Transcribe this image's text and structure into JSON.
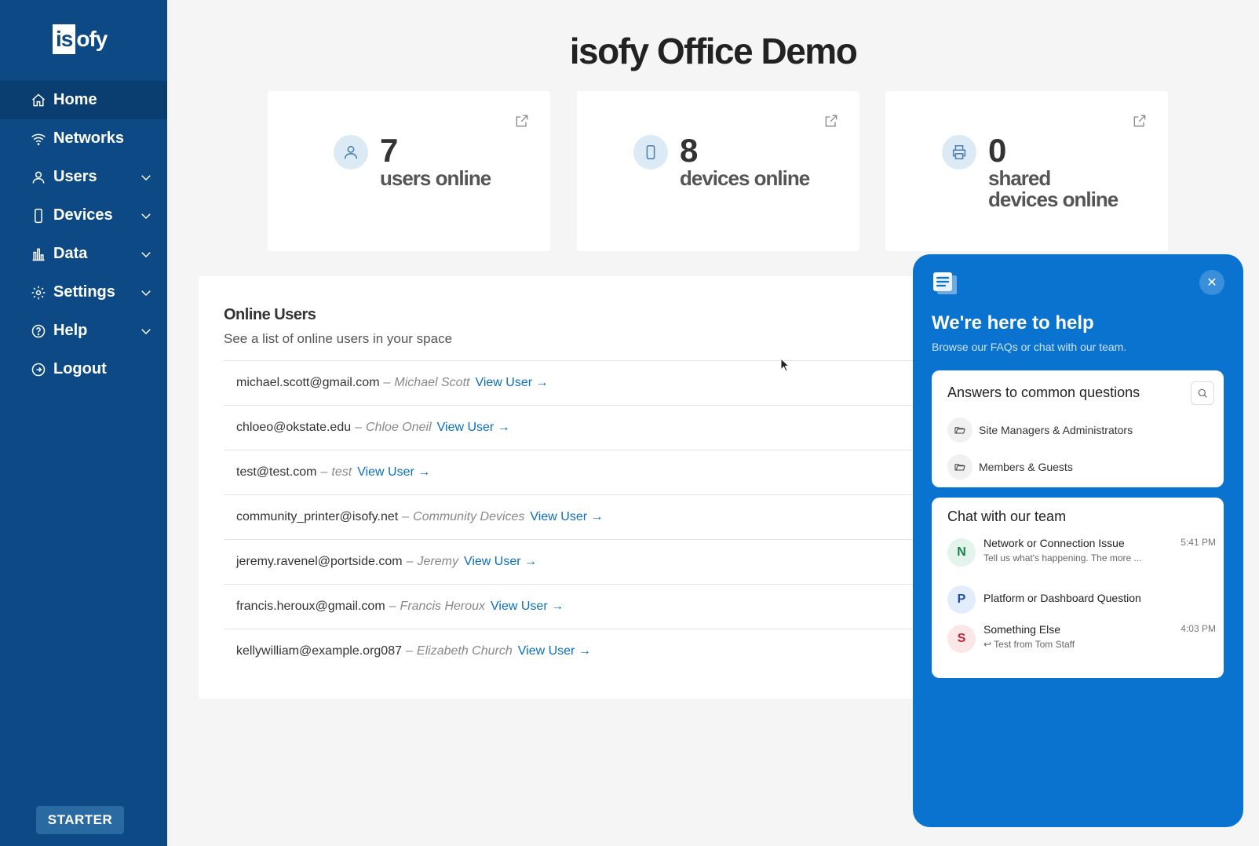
{
  "sidebar": {
    "logo_box": "is",
    "logo_rest": "ofy",
    "items": [
      {
        "label": "Home"
      },
      {
        "label": "Networks"
      },
      {
        "label": "Users"
      },
      {
        "label": "Devices"
      },
      {
        "label": "Data"
      },
      {
        "label": "Settings"
      },
      {
        "label": "Help"
      },
      {
        "label": "Logout"
      }
    ],
    "plan": "STARTER"
  },
  "main": {
    "title": "isofy Office Demo",
    "stats": [
      {
        "value": "7",
        "label_line1": "users online",
        "label_line2": ""
      },
      {
        "value": "8",
        "label_line1": "devices online",
        "label_line2": ""
      },
      {
        "value": "0",
        "label_line1": "shared",
        "label_line2": "devices online"
      }
    ],
    "online_users": {
      "title": "Online Users",
      "subtitle": "See a list of online users in your space",
      "link_label": "View User →",
      "rows": [
        {
          "email": "michael.scott@gmail.com",
          "name": "Michael Scott"
        },
        {
          "email": "chloeo@okstate.edu",
          "name": "Chloe Oneil"
        },
        {
          "email": "test@test.com",
          "name": "test"
        },
        {
          "email": "community_printer@isofy.net",
          "name": "Community Devices"
        },
        {
          "email": "jeremy.ravenel@portside.com",
          "name": "Jeremy"
        },
        {
          "email": "francis.heroux@gmail.com",
          "name": "Francis Heroux"
        },
        {
          "email": "kellywilliam@example.org087",
          "name": "Elizabeth Church"
        }
      ]
    }
  },
  "help_widget": {
    "title": "We're here to help",
    "subtitle": "Browse our FAQs or chat with our team.",
    "faq": {
      "title": "Answers to common questions",
      "items": [
        "Site Managers & Administrators",
        "Members & Guests"
      ]
    },
    "chat": {
      "title": "Chat with our team",
      "conversations": [
        {
          "initial": "N",
          "title": "Network or Connection Issue",
          "preview": "Tell us what's happening. The more ...",
          "time": "5:41 PM",
          "color": "#1a7f4b",
          "bg": "#e3f4ea"
        },
        {
          "initial": "P",
          "title": "Platform or Dashboard Question",
          "preview": "",
          "time": "",
          "color": "#1f4fa8",
          "bg": "#e3ecfa"
        },
        {
          "initial": "S",
          "title": "Something Else",
          "preview": "↩ Test from Tom Staff",
          "time": "4:03 PM",
          "color": "#c0283a",
          "bg": "#fbe6e8"
        }
      ]
    }
  },
  "colors": {
    "sidebar": "#0d4a85",
    "sidebar_active": "#0a3d70",
    "link": "#0a6dc7",
    "widget": "#0a73d0"
  }
}
